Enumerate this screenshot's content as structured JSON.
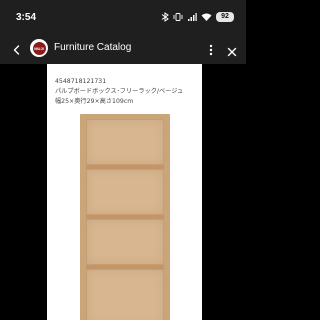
{
  "status_bar": {
    "time": "3:54",
    "battery": "92",
    "icons": [
      "bluetooth-icon",
      "vibrate-icon",
      "signal-icon",
      "wifi-icon",
      "battery-icon"
    ]
  },
  "app_bar": {
    "title": "Furniture Catalog",
    "logo_text": "MUJI",
    "accent": "#8d1a1a",
    "background": "#1f1f1f"
  },
  "product": {
    "code": "4548718121731",
    "name": "パルプボードボックス･フリーラック/ベージュ",
    "dimensions": "幅25×奥行29×高さ109cm",
    "wood_color": "#d8b68f"
  }
}
